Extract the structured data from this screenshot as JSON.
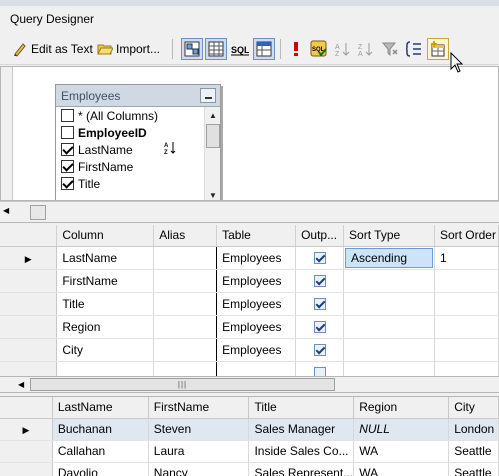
{
  "window": {
    "title": "Query Designer"
  },
  "toolbar": {
    "edit_as_text": "Edit as Text",
    "import": "Import...",
    "icons": [
      "diagram-pane-icon",
      "grid-pane-icon",
      "sql-pane-icon",
      "results-pane-icon",
      "run-icon",
      "verify-sql-icon",
      "sort-ascending-icon",
      "sort-descending-icon",
      "remove-filter-icon",
      "use-groupby-icon",
      "add-table-icon"
    ]
  },
  "diagram": {
    "table_name": "Employees",
    "columns": [
      {
        "label": "* (All Columns)",
        "checked": false,
        "bold": false
      },
      {
        "label": "EmployeeID",
        "checked": false,
        "bold": true
      },
      {
        "label": "LastName",
        "checked": true,
        "bold": false,
        "sort": "ascending"
      },
      {
        "label": "FirstName",
        "checked": true,
        "bold": false
      },
      {
        "label": "Title",
        "checked": true,
        "bold": false
      }
    ]
  },
  "criteria": {
    "headers": [
      "Column",
      "Alias",
      "Table",
      "Outp...",
      "Sort Type",
      "Sort Order"
    ],
    "rows": [
      {
        "column": "LastName",
        "alias": "",
        "table": "Employees",
        "output": true,
        "sort_type": "Ascending",
        "sort_order": "1"
      },
      {
        "column": "FirstName",
        "alias": "",
        "table": "Employees",
        "output": true,
        "sort_type": "",
        "sort_order": ""
      },
      {
        "column": "Title",
        "alias": "",
        "table": "Employees",
        "output": true,
        "sort_type": "",
        "sort_order": ""
      },
      {
        "column": "Region",
        "alias": "",
        "table": "Employees",
        "output": true,
        "sort_type": "",
        "sort_order": ""
      },
      {
        "column": "City",
        "alias": "",
        "table": "Employees",
        "output": true,
        "sort_type": "",
        "sort_order": ""
      }
    ]
  },
  "results": {
    "headers": [
      "LastName",
      "FirstName",
      "Title",
      "Region",
      "City"
    ],
    "rows": [
      [
        "Buchanan",
        "Steven",
        "Sales Manager",
        "NULL",
        "London"
      ],
      [
        "Callahan",
        "Laura",
        "Inside Sales Co...",
        "WA",
        "Seattle"
      ],
      [
        "Davolio",
        "Nancy",
        "Sales Represent...",
        "WA",
        "Seattle"
      ]
    ]
  },
  "colors": {
    "selection": "#cde3f8",
    "header_bg": "#f0f0f0",
    "table_head": "#cfd8e3",
    "run_red": "#d00000"
  }
}
